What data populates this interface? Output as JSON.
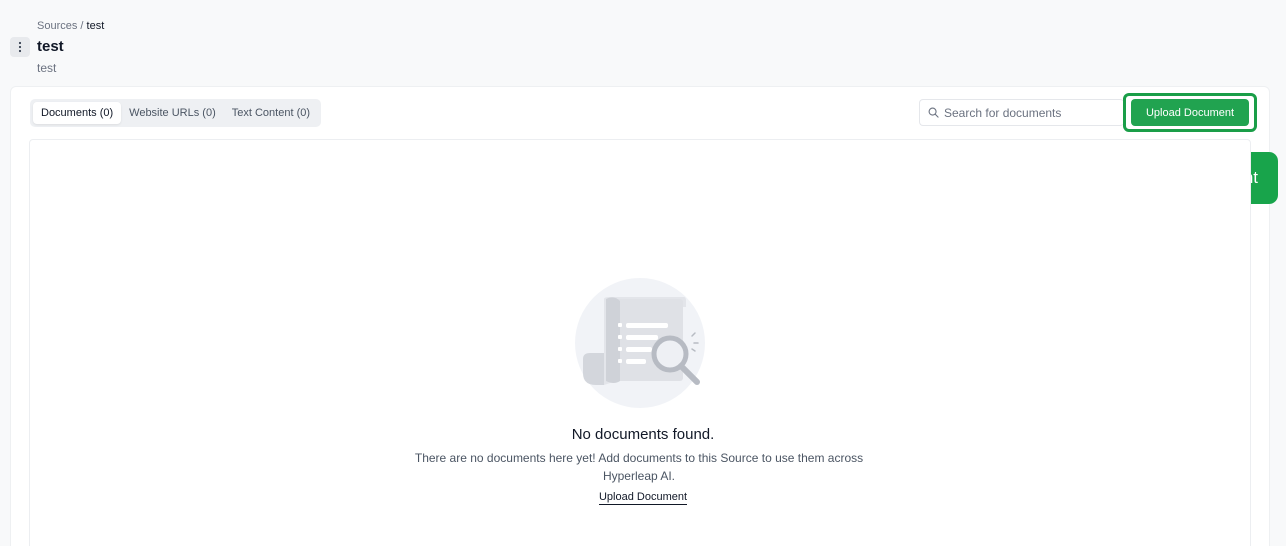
{
  "breadcrumb": {
    "parent": "Sources",
    "separator": " / ",
    "current": "test"
  },
  "header": {
    "title": "test",
    "subtitle": "test"
  },
  "tabs": [
    {
      "label": "Documents (0)",
      "active": true
    },
    {
      "label": "Website URLs (0)",
      "active": false
    },
    {
      "label": "Text Content (0)",
      "active": false
    }
  ],
  "search": {
    "placeholder": "Search for documents",
    "value": ""
  },
  "toolbar": {
    "upload_label": "Upload Document"
  },
  "tooltip": {
    "text": "Upload Document"
  },
  "empty_state": {
    "title": "No documents found.",
    "description": "There are no documents here yet! Add documents to this Source to use them across Hyperleap AI.",
    "link_label": "Upload Document"
  },
  "colors": {
    "accent": "#21a350",
    "tooltip_bg": "#18a44b",
    "highlight_border": "#1a9e48",
    "page_bg": "#f8f9fa"
  },
  "icons": {
    "menu": "kebab-vertical-icon",
    "search": "search-icon",
    "empty": "document-search-illustration"
  }
}
